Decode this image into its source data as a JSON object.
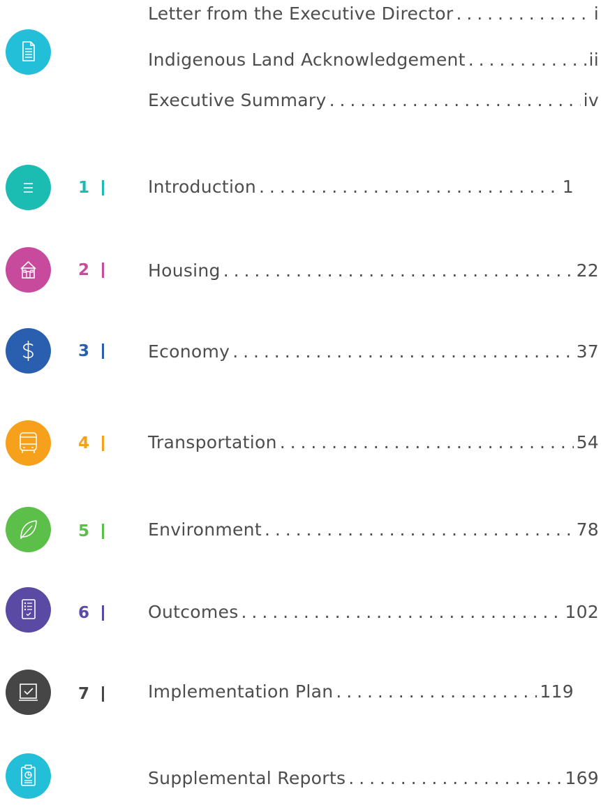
{
  "front_matter": {
    "items": [
      {
        "title": "Letter from the Executive Director",
        "page": "i"
      },
      {
        "title": "Indigenous Land Acknowledgement",
        "page": "ii"
      },
      {
        "title": "Executive Summary",
        "page": "iv"
      }
    ],
    "icon": "document-icon",
    "icon_color": "#23bfd9"
  },
  "chapters": [
    {
      "number": "1",
      "title": "Introduction",
      "page": "1",
      "color": "#1bbcb2",
      "icon": "list-icon"
    },
    {
      "number": "2",
      "title": "Housing",
      "page": "22",
      "color": "#c84a9c",
      "icon": "house-icon"
    },
    {
      "number": "3",
      "title": "Economy",
      "page": "37",
      "color": "#2a5fb0",
      "icon": "dollar-icon"
    },
    {
      "number": "4",
      "title": "Transportation",
      "page": "54",
      "color": "#f7a01c",
      "icon": "bus-icon"
    },
    {
      "number": "5",
      "title": "Environment",
      "page": "78",
      "color": "#5cbf4a",
      "icon": "leaf-icon"
    },
    {
      "number": "6",
      "title": "Outcomes",
      "page": "102",
      "color": "#5b4aa3",
      "icon": "checklist-icon"
    },
    {
      "number": "7",
      "title": "Implementation Plan",
      "page": "119",
      "color": "#464646",
      "icon": "checkbox-icon"
    }
  ],
  "supplemental": {
    "title": "Supplemental Reports",
    "page": "169",
    "color": "#23bfd9",
    "icon": "clipboard-chart-icon"
  }
}
